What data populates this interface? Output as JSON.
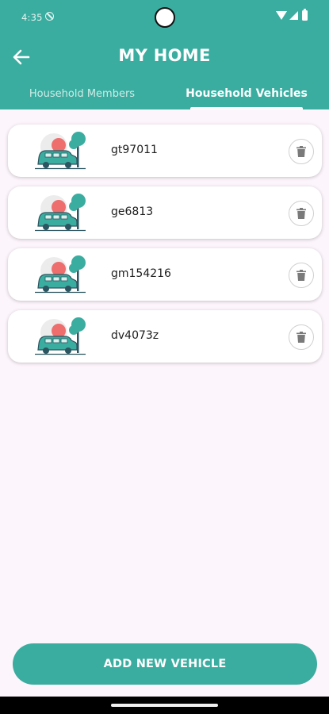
{
  "status_bar": {
    "time": "4:35"
  },
  "header": {
    "title": "MY HOME"
  },
  "tabs": [
    {
      "label": "Household Members",
      "selected": false
    },
    {
      "label": "Household Vehicles",
      "selected": true
    }
  ],
  "vehicles": [
    {
      "plate": "gt97011"
    },
    {
      "plate": "ge6813"
    },
    {
      "plate": "gm154216"
    },
    {
      "plate": "dv4073z"
    }
  ],
  "actions": {
    "add_vehicle_label": "ADD NEW VEHICLE"
  },
  "colors": {
    "accent": "#3aada0",
    "background": "#fcf5fb",
    "sun": "#ee6e6e"
  },
  "icons": {
    "back": "arrow-left-icon",
    "delete": "trash-icon",
    "vehicle": "car-illustration-icon"
  }
}
